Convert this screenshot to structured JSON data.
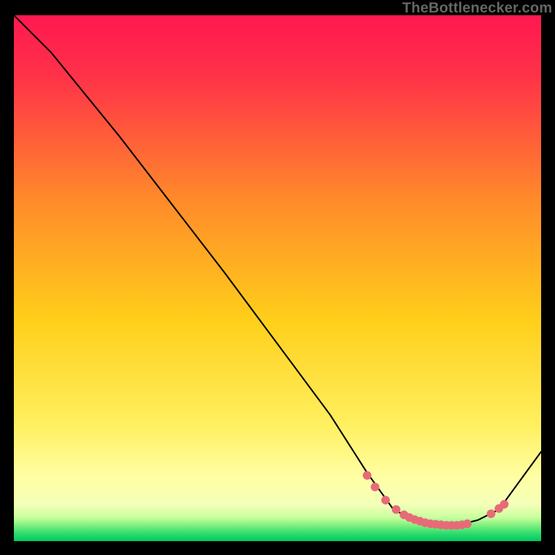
{
  "watermark": "TheBottlenecker.com",
  "chart_data": {
    "type": "line",
    "title": "",
    "xlabel": "",
    "ylabel": "",
    "xlim": [
      0,
      100
    ],
    "ylim": [
      0,
      100
    ],
    "background_gradient": {
      "top_color": "#ff1a4a",
      "mid_color": "#ffd400",
      "near_bottom_color": "#ffff99",
      "bottom_color": "#00d062"
    },
    "series": [
      {
        "name": "bottleneck-curve",
        "color": "#000000",
        "x": [
          0,
          7,
          20,
          40,
          60,
          67,
          72,
          78,
          84,
          88,
          92,
          100
        ],
        "y": [
          100,
          93,
          77,
          51,
          24,
          13,
          6,
          3,
          3,
          4,
          6,
          17
        ]
      }
    ],
    "markers": {
      "name": "highlight-dots",
      "color": "#e86a78",
      "x": [
        67.0,
        68.5,
        70.5,
        72.5,
        74.0,
        75.0,
        76.0,
        77.0,
        78.0,
        79.0,
        80.0,
        81.0,
        82.0,
        83.0,
        84.0,
        85.0,
        86.0,
        90.5,
        92.0,
        93.0
      ],
      "y": [
        12.5,
        10.3,
        7.8,
        6.0,
        5.0,
        4.5,
        4.1,
        3.8,
        3.5,
        3.3,
        3.2,
        3.1,
        3.0,
        3.0,
        3.0,
        3.1,
        3.3,
        5.2,
        6.2,
        7.0
      ]
    }
  }
}
